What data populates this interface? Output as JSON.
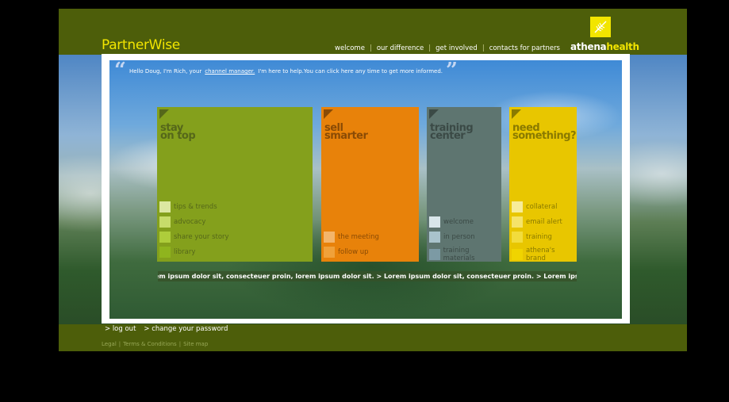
{
  "header": {
    "logo": "PartnerWise",
    "nav": [
      "welcome",
      "our difference",
      "get involved",
      "contacts for partners"
    ],
    "nav_separator": "|",
    "brand_main": "athena",
    "brand_accent": "health"
  },
  "intro": {
    "open_quote": "“",
    "close_quote": "”",
    "text_before": "Hello Doug, I'm Rich, your",
    "link": "channel manager.",
    "text_after": "I'm here to help.You can click here any time to get more informed."
  },
  "tiles": [
    {
      "title_line1": "stay",
      "title_line2": "on top",
      "color": "#84a01c",
      "text_color": "#55671a",
      "items": [
        "tips & trends",
        "advocacy",
        "share your story",
        "library"
      ],
      "swatches": [
        "#dce7a2",
        "#c7dc6a",
        "#aecd3b",
        "#8fb41e"
      ]
    },
    {
      "title_line1": "sell",
      "title_line2": "smarter",
      "color": "#e8820a",
      "text_color": "#8a4b05",
      "items": [
        "the meeting",
        "follow up"
      ],
      "swatches": [
        "#f3b56b",
        "#f0a13a"
      ]
    },
    {
      "title_line1": "training",
      "title_line2": "center",
      "color": "#5e7570",
      "text_color": "#3b4a46",
      "items": [
        "welcome",
        "in person",
        "training materials"
      ],
      "swatches": [
        "#d9e6ea",
        "#a9c3cc",
        "#7c9aa4"
      ]
    },
    {
      "title_line1": "need",
      "title_line2": "something?",
      "color": "#e8c600",
      "text_color": "#8a7a00",
      "items": [
        "collateral",
        "email alert",
        "training",
        "athena's brand"
      ],
      "swatches": [
        "#f7ec9a",
        "#f5e36a",
        "#f2dc3c",
        "#f0d400"
      ]
    }
  ],
  "ticker": "em ipsum dolor sit, consecteuer proin, lorem ipsum dolor sit.    > Lorem ipsum dolor sit, consecteuer proin.    > Lorem ipsum dolc",
  "bottom_links": [
    "> log out",
    "> change your password"
  ],
  "footer": {
    "links": [
      "Legal",
      "Terms & Conditions",
      "Site map"
    ],
    "separator": "|"
  }
}
